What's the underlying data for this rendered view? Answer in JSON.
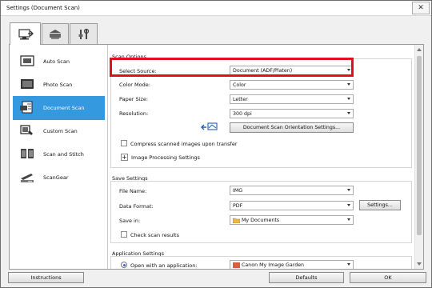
{
  "window": {
    "title": "Settings (Document Scan)",
    "close_label": "✕"
  },
  "tabs": [
    {
      "icon": "scan-from-computer-icon"
    },
    {
      "icon": "scan-from-panel-icon"
    },
    {
      "icon": "general-settings-icon"
    }
  ],
  "sidebar": {
    "items": [
      {
        "label": "Auto Scan",
        "icon": "auto-scan-icon"
      },
      {
        "label": "Photo Scan",
        "icon": "photo-scan-icon"
      },
      {
        "label": "Document Scan",
        "icon": "document-scan-icon",
        "selected": true
      },
      {
        "label": "Custom Scan",
        "icon": "custom-scan-icon"
      },
      {
        "label": "Scan and Stitch",
        "icon": "scan-and-stitch-icon"
      },
      {
        "label": "ScanGear",
        "icon": "scangear-icon"
      }
    ]
  },
  "scan_options": {
    "title": "Scan Options",
    "select_source": {
      "label": "Select Source:",
      "value": "Document (ADF/Platen)"
    },
    "color_mode": {
      "label": "Color Mode:",
      "value": "Color"
    },
    "paper_size": {
      "label": "Paper Size:",
      "value": "Letter"
    },
    "resolution": {
      "label": "Resolution:",
      "value": "300 dpi"
    },
    "orientation_button": "Document Scan Orientation Settings...",
    "compress_checkbox": "Compress scanned images upon transfer",
    "image_processing": "Image Processing Settings"
  },
  "save_settings": {
    "title": "Save Settings",
    "file_name": {
      "label": "File Name:",
      "value": "IMG"
    },
    "data_format": {
      "label": "Data Format:",
      "value": "PDF",
      "button": "Settings..."
    },
    "save_in": {
      "label": "Save in:",
      "value": "My Documents"
    },
    "check_results": "Check scan results"
  },
  "application_settings": {
    "title": "Application Settings",
    "open_with": {
      "label": "Open with an application:",
      "value": "Canon My Image Garden"
    }
  },
  "footer": {
    "instructions": "Instructions",
    "defaults": "Defaults",
    "ok": "OK"
  },
  "colors": {
    "selection": "#3599e0",
    "highlight": "#e0101e"
  }
}
